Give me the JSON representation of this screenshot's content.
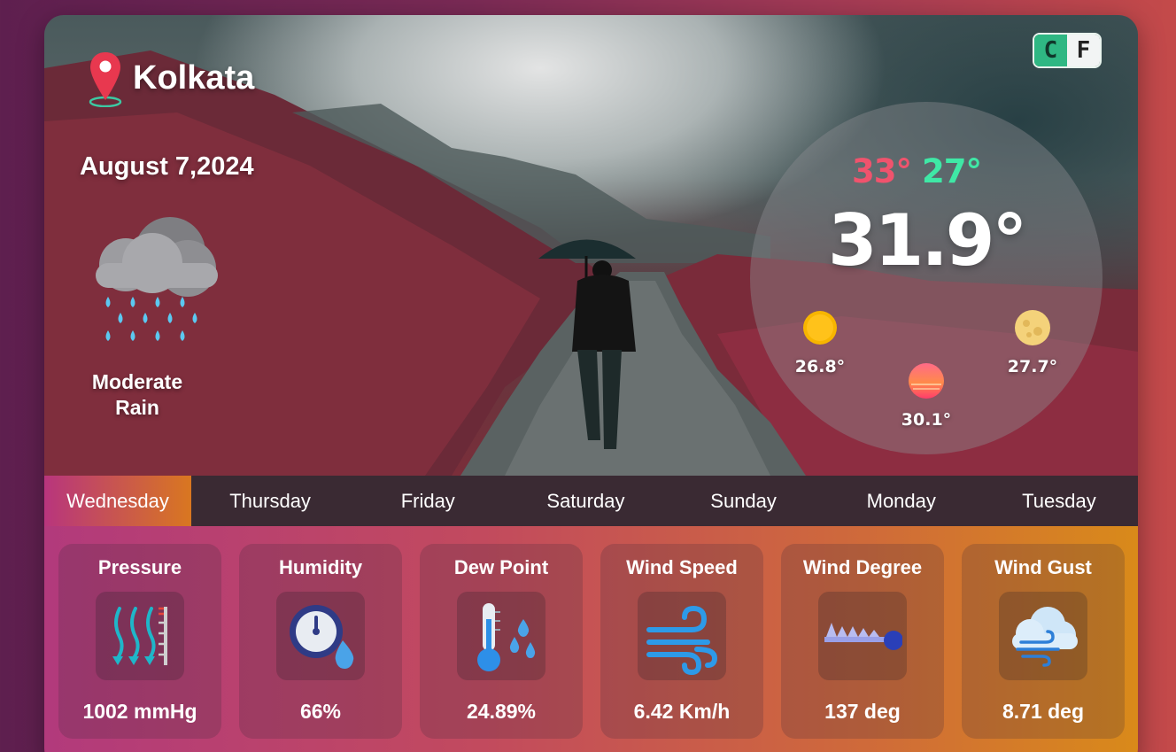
{
  "location": {
    "city": "Kolkata"
  },
  "date": "August 7,2024",
  "condition": {
    "line1": "Moderate",
    "line2": "Rain",
    "icon": "rain-cloud-icon"
  },
  "units": {
    "celsius": "C",
    "fahrenheit": "F",
    "selected": "C"
  },
  "temperature": {
    "max": "33°",
    "min": "27°",
    "current": "31.9°"
  },
  "sun": {
    "morning": {
      "value": "26.8°",
      "icon": "sun-icon"
    },
    "evening": {
      "value": "30.1°",
      "icon": "sunset-icon"
    },
    "night": {
      "value": "27.7°",
      "icon": "moon-icon"
    }
  },
  "days": [
    "Wednesday",
    "Thursday",
    "Friday",
    "Saturday",
    "Sunday",
    "Monday",
    "Tuesday"
  ],
  "active_day": "Wednesday",
  "metrics": [
    {
      "label": "Pressure",
      "value": "1002 mmHg",
      "icon": "pressure-icon"
    },
    {
      "label": "Humidity",
      "value": "66%",
      "icon": "humidity-icon"
    },
    {
      "label": "Dew Point",
      "value": "24.89%",
      "icon": "dew-point-icon"
    },
    {
      "label": "Wind Speed",
      "value": "6.42 Km/h",
      "icon": "wind-speed-icon"
    },
    {
      "label": "Wind Degree",
      "value": "137 deg",
      "icon": "wind-degree-icon"
    },
    {
      "label": "Wind Gust",
      "value": "8.71 deg",
      "icon": "wind-gust-icon"
    }
  ],
  "colors": {
    "max_temp": "#f0536d",
    "min_temp": "#3fe8a6",
    "unit_active": "#2fb783",
    "tab_bar": "#3a2a33"
  }
}
